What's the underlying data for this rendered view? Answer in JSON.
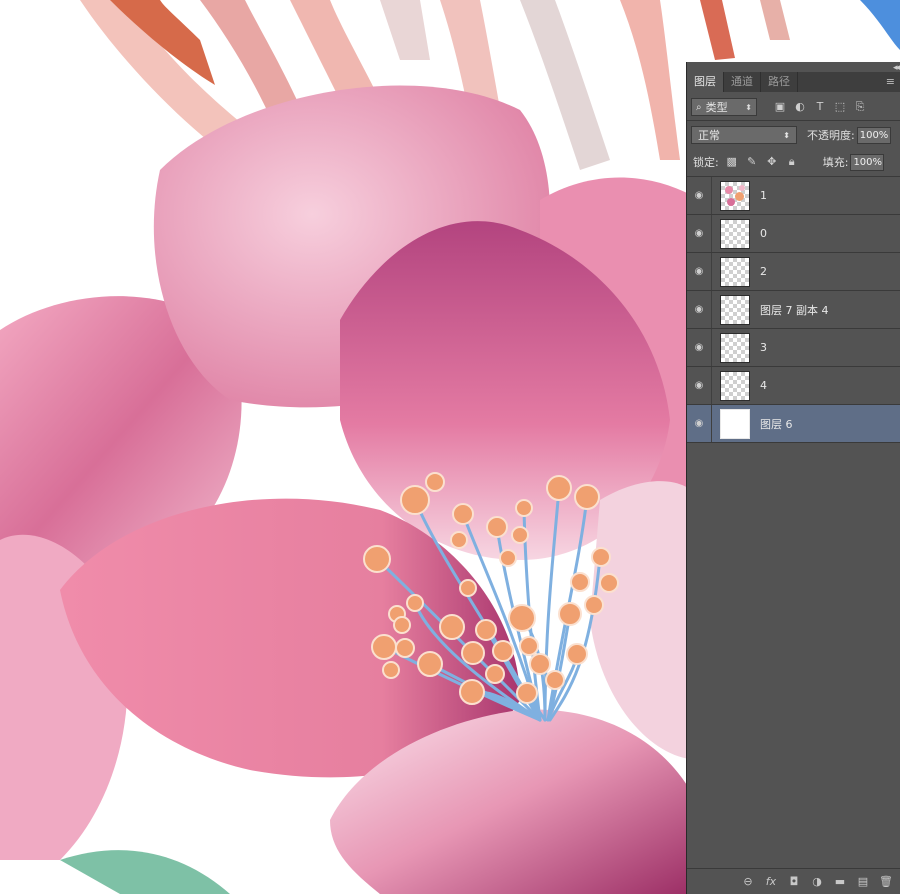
{
  "panel": {
    "tabs": [
      {
        "label": "图层",
        "active": true
      },
      {
        "label": "通道",
        "active": false
      },
      {
        "label": "路径",
        "active": false
      }
    ],
    "filter": {
      "kind_label": "类型",
      "icons": [
        "image-filter-icon",
        "adjustment-filter-icon",
        "type-filter-icon",
        "shape-filter-icon",
        "smart-object-filter-icon"
      ]
    },
    "blend_mode": "正常",
    "opacity_label": "不透明度:",
    "opacity_value": "100%",
    "lock_label": "锁定:",
    "lock_icons": [
      "lock-transparent-icon",
      "lock-paint-icon",
      "lock-move-icon",
      "lock-all-icon"
    ],
    "fill_label": "填充:",
    "fill_value": "100%",
    "layers": [
      {
        "name": "1",
        "visible": true,
        "selected": false,
        "thumb": "flowers"
      },
      {
        "name": "0",
        "visible": true,
        "selected": false,
        "thumb": "transparent"
      },
      {
        "name": "2",
        "visible": true,
        "selected": false,
        "thumb": "transparent"
      },
      {
        "name": "图层 7 副本 4",
        "visible": true,
        "selected": false,
        "thumb": "transparent"
      },
      {
        "name": "3",
        "visible": true,
        "selected": false,
        "thumb": "transparent"
      },
      {
        "name": "4",
        "visible": true,
        "selected": false,
        "thumb": "transparent"
      },
      {
        "name": "图层 6",
        "visible": true,
        "selected": true,
        "thumb": "white"
      }
    ],
    "bottom_icons": [
      "link-layers-icon",
      "fx-icon",
      "add-mask-icon",
      "adjustment-layer-icon",
      "new-group-icon",
      "new-layer-icon",
      "delete-layer-icon"
    ]
  },
  "colors": {
    "panel_bg": "#535353",
    "selected_layer": "#5f6e87",
    "petal_pink": "#e98aa8",
    "stamen_orange": "#f0a070",
    "filament_blue": "#7fb0e0"
  }
}
